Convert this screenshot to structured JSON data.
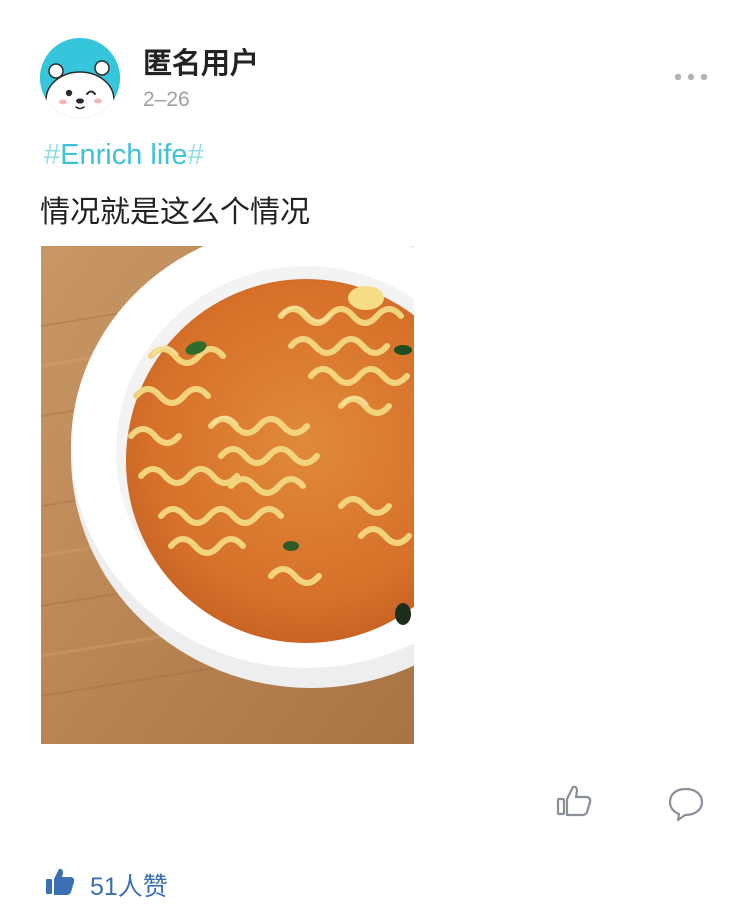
{
  "post": {
    "author": "匿名用户",
    "date": "2–26",
    "topic": {
      "hash": "#",
      "name": "Enrich life"
    },
    "text": "情况就是这么个情况",
    "image_alt": "一碗泡面"
  },
  "actions": {
    "like_icon": "thumbs-up-icon",
    "comment_icon": "comment-bubble-icon",
    "more_icon": "more-dots-icon"
  },
  "likes": {
    "icon": "thumbs-up-filled-icon",
    "count_text": "51人赞"
  },
  "colors": {
    "avatar_bg": "#35c6dc",
    "topic": "#3fc3d8",
    "likes": "#3a6fb4",
    "icon_gray": "#8a8f99"
  }
}
